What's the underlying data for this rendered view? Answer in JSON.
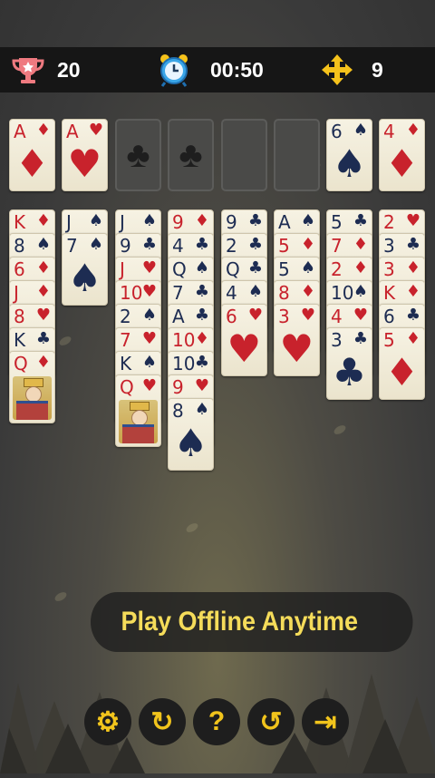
{
  "header": {
    "score": "20",
    "score_icon": "trophy-icon",
    "timer": "00:50",
    "timer_icon": "alarm-clock-icon",
    "moves": "9",
    "moves_icon": "move-arrows-icon"
  },
  "foundations": [
    {
      "rank": "A",
      "suit": "♦",
      "color": "red"
    },
    {
      "rank": "A",
      "suit": "♥",
      "color": "red"
    },
    {
      "empty": true,
      "suit": "♣"
    },
    {
      "empty": true,
      "suit": "♣"
    }
  ],
  "free_cells": [
    {
      "empty": true
    },
    {
      "empty": true
    },
    {
      "rank": "6",
      "suit": "♠",
      "color": "blk"
    },
    {
      "rank": "4",
      "suit": "♦",
      "color": "red"
    }
  ],
  "tableau": [
    [
      {
        "rank": "K",
        "suit": "♦",
        "color": "red"
      },
      {
        "rank": "8",
        "suit": "♠",
        "color": "blk"
      },
      {
        "rank": "6",
        "suit": "♦",
        "color": "red"
      },
      {
        "rank": "J",
        "suit": "♦",
        "color": "red"
      },
      {
        "rank": "8",
        "suit": "♥",
        "color": "red"
      },
      {
        "rank": "K",
        "suit": "♣",
        "color": "blk"
      },
      {
        "rank": "Q",
        "suit": "♦",
        "color": "red",
        "face": true
      }
    ],
    [
      {
        "rank": "J",
        "suit": "♠",
        "color": "blk"
      },
      {
        "rank": "7",
        "suit": "♠",
        "color": "blk"
      }
    ],
    [
      {
        "rank": "J",
        "suit": "♠",
        "color": "blk"
      },
      {
        "rank": "9",
        "suit": "♣",
        "color": "blk"
      },
      {
        "rank": "J",
        "suit": "♥",
        "color": "red"
      },
      {
        "rank": "10",
        "suit": "♥",
        "color": "red"
      },
      {
        "rank": "2",
        "suit": "♠",
        "color": "blk"
      },
      {
        "rank": "7",
        "suit": "♥",
        "color": "red"
      },
      {
        "rank": "K",
        "suit": "♠",
        "color": "blk"
      },
      {
        "rank": "Q",
        "suit": "♥",
        "color": "red",
        "face": true
      }
    ],
    [
      {
        "rank": "9",
        "suit": "♦",
        "color": "red"
      },
      {
        "rank": "4",
        "suit": "♣",
        "color": "blk"
      },
      {
        "rank": "Q",
        "suit": "♠",
        "color": "blk"
      },
      {
        "rank": "7",
        "suit": "♣",
        "color": "blk"
      },
      {
        "rank": "A",
        "suit": "♣",
        "color": "blk"
      },
      {
        "rank": "10",
        "suit": "♦",
        "color": "red"
      },
      {
        "rank": "10",
        "suit": "♣",
        "color": "blk"
      },
      {
        "rank": "9",
        "suit": "♥",
        "color": "red"
      },
      {
        "rank": "8",
        "suit": "♠",
        "color": "blk"
      }
    ],
    [
      {
        "rank": "9",
        "suit": "♣",
        "color": "blk"
      },
      {
        "rank": "2",
        "suit": "♣",
        "color": "blk"
      },
      {
        "rank": "Q",
        "suit": "♣",
        "color": "blk"
      },
      {
        "rank": "4",
        "suit": "♠",
        "color": "blk"
      },
      {
        "rank": "6",
        "suit": "♥",
        "color": "red"
      }
    ],
    [
      {
        "rank": "A",
        "suit": "♠",
        "color": "blk"
      },
      {
        "rank": "5",
        "suit": "♦",
        "color": "red"
      },
      {
        "rank": "5",
        "suit": "♠",
        "color": "blk"
      },
      {
        "rank": "8",
        "suit": "♦",
        "color": "red"
      },
      {
        "rank": "3",
        "suit": "♥",
        "color": "red"
      }
    ],
    [
      {
        "rank": "5",
        "suit": "♣",
        "color": "blk"
      },
      {
        "rank": "7",
        "suit": "♦",
        "color": "red"
      },
      {
        "rank": "2",
        "suit": "♦",
        "color": "red"
      },
      {
        "rank": "10",
        "suit": "♠",
        "color": "blk"
      },
      {
        "rank": "4",
        "suit": "♥",
        "color": "red"
      },
      {
        "rank": "3",
        "suit": "♣",
        "color": "blk"
      }
    ],
    [
      {
        "rank": "2",
        "suit": "♥",
        "color": "red"
      },
      {
        "rank": "3",
        "suit": "♣",
        "color": "blk"
      },
      {
        "rank": "3",
        "suit": "♦",
        "color": "red"
      },
      {
        "rank": "K",
        "suit": "♦",
        "color": "red"
      },
      {
        "rank": "6",
        "suit": "♣",
        "color": "blk"
      },
      {
        "rank": "5",
        "suit": "♦",
        "color": "red"
      }
    ]
  ],
  "banner": {
    "text": "Play Offline Anytime"
  },
  "toolbar": [
    {
      "name": "settings-button",
      "icon": "gear-icon",
      "glyph": "⚙"
    },
    {
      "name": "restart-button",
      "icon": "restart-icon",
      "glyph": "↻"
    },
    {
      "name": "help-button",
      "icon": "question-icon",
      "glyph": "?"
    },
    {
      "name": "undo-button",
      "icon": "undo-icon",
      "glyph": "↺"
    },
    {
      "name": "exit-button",
      "icon": "exit-door-icon",
      "glyph": "⇥"
    }
  ],
  "colors": {
    "red": "#c8222c",
    "black": "#1d2c52",
    "accent": "#f1c41c"
  }
}
